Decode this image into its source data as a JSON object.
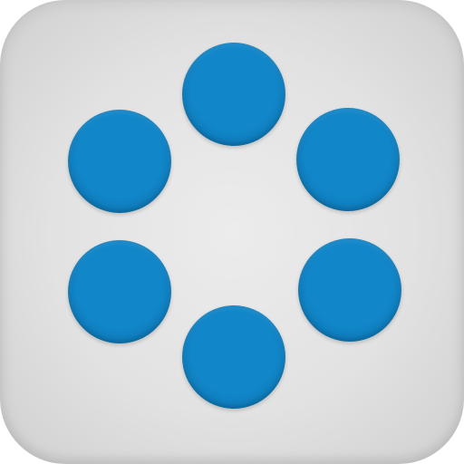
{
  "app_icon": {
    "icon_name": "six-dot-ring-icon",
    "colors": {
      "background": "#e3e3e3",
      "dot_core": "#1186c8",
      "dot_edge": "#0a6aa6"
    },
    "dots": [
      {
        "name": "dot-top"
      },
      {
        "name": "dot-upper-right"
      },
      {
        "name": "dot-lower-right"
      },
      {
        "name": "dot-bottom"
      },
      {
        "name": "dot-lower-left"
      },
      {
        "name": "dot-upper-left"
      }
    ]
  }
}
